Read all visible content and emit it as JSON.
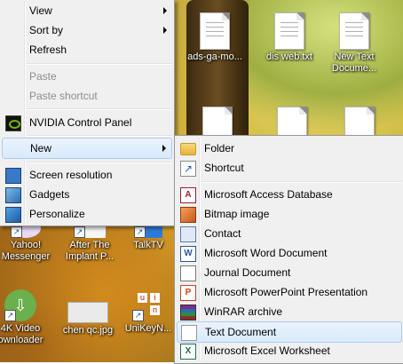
{
  "desktop_icons": [
    {
      "name": "icon-ads-ga-mo",
      "label": "ads-ga-mo..."
    },
    {
      "name": "icon-dis-web",
      "label": "dis web.txt"
    },
    {
      "name": "icon-new-text-document",
      "label": "New Text Docume..."
    },
    {
      "name": "icon-yahoo-messenger",
      "label": "Yahoo! Messenger"
    },
    {
      "name": "icon-after-the-implant",
      "label": "After The Implant P..."
    },
    {
      "name": "icon-talktv",
      "label": "TalkTV"
    },
    {
      "name": "icon-4k-video-downloader",
      "label": "4K Video ownloader"
    },
    {
      "name": "icon-chen-qc",
      "label": "chen qc.jpg"
    },
    {
      "name": "icon-unikeyn",
      "label": "UniKeyN..."
    }
  ],
  "context_menu": {
    "items": [
      {
        "label": "View"
      },
      {
        "label": "Sort by"
      },
      {
        "label": "Refresh"
      },
      {
        "label": "Paste"
      },
      {
        "label": "Paste shortcut"
      },
      {
        "label": "NVIDIA Control Panel"
      },
      {
        "label": "New"
      },
      {
        "label": "Screen resolution"
      },
      {
        "label": "Gadgets"
      },
      {
        "label": "Personalize"
      }
    ]
  },
  "new_submenu": {
    "items": [
      {
        "label": "Folder"
      },
      {
        "label": "Shortcut"
      },
      {
        "label": "Microsoft Access Database"
      },
      {
        "label": "Bitmap image"
      },
      {
        "label": "Contact"
      },
      {
        "label": "Microsoft Word Document"
      },
      {
        "label": "Journal Document"
      },
      {
        "label": "Microsoft PowerPoint Presentation"
      },
      {
        "label": "WinRAR archive"
      },
      {
        "label": "Text Document"
      },
      {
        "label": "Microsoft Excel Worksheet"
      }
    ]
  },
  "colors": {
    "menu_bg": "#f0f0f0",
    "highlight": "#d9e9fc",
    "disabled_text": "#8d8d8d"
  }
}
